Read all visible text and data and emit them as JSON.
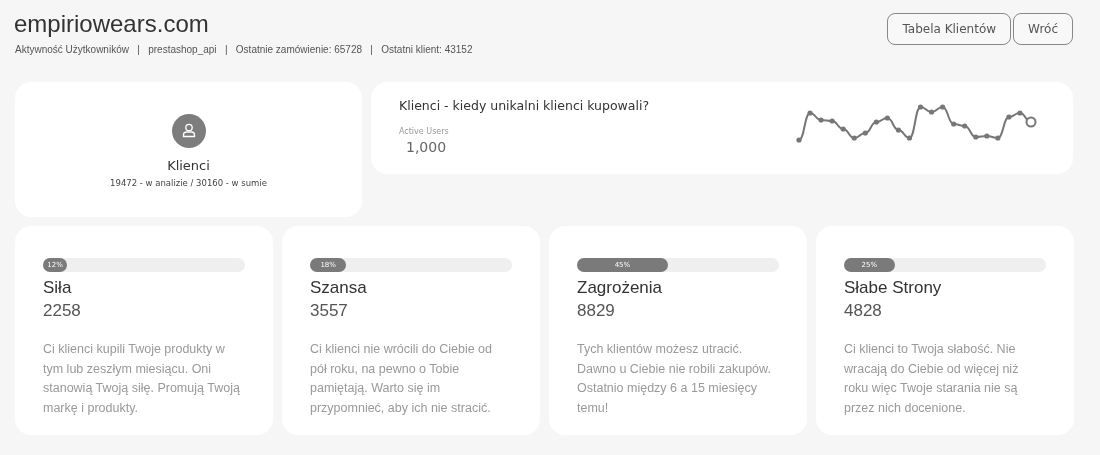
{
  "header": {
    "title": "empiriowears.com",
    "meta": "Aktywność Użytkowników   |   prestashop_api   |   Ostatnie zamówienie: 65728   |   Ostatni klient: 43152",
    "buttons": [
      "Tabela Klientów",
      "Wróć"
    ]
  },
  "clients_card": {
    "title": "Klienci",
    "summary": "19472 - w analizie / 30160 - w sumie"
  },
  "activity_card": {
    "title": "Klienci - kiedy unikalni klienci kupowali?",
    "metric_label": "Active Users",
    "metric_value": "1,000"
  },
  "segments": [
    {
      "percent": "12%",
      "level": 0.12,
      "name": "Siła",
      "count": "2258",
      "description": "Ci klienci kupili Twoje produkty w tym lub zeszłym miesiącu. Oni stanowią Twoją siłę. Promują Twoją markę i produkty."
    },
    {
      "percent": "18%",
      "level": 0.18,
      "name": "Szansa",
      "count": "3557",
      "description": "Ci klienci nie wrócili do Ciebie od pół roku, na pewno o Tobie pamiętają. Warto się im przypomnieć, aby ich nie stracić."
    },
    {
      "percent": "45%",
      "level": 0.45,
      "name": "Zagrożenia",
      "count": "8829",
      "description": "Tych klientów możesz utracić. Dawno u Ciebie nie robili zakupów. Ostatnio między 6 a 15 miesięcy temu!"
    },
    {
      "percent": "25%",
      "level": 0.25,
      "name": "Słabe Strony",
      "count": "4828",
      "description": "Ci klienci to Twoja słabość. Nie wracają do Ciebie od więcej niż roku więc Twoje starania nie są przez nich docenione."
    }
  ]
}
